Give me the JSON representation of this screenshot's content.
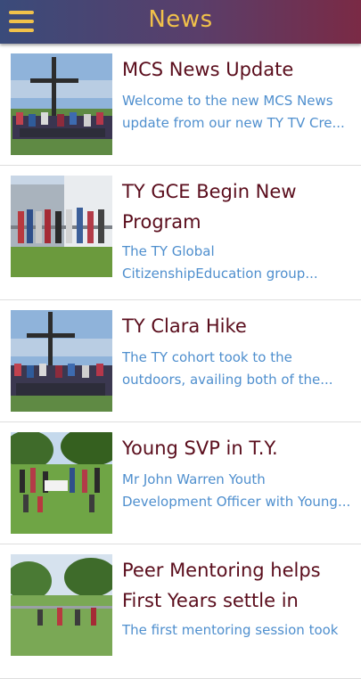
{
  "header": {
    "title": "News",
    "menu_icon": "hamburger-menu-icon"
  },
  "colors": {
    "accent": "#f1c14a",
    "title": "#5a0d1c",
    "link": "#4f8fce"
  },
  "news": [
    {
      "title": "MCS News Update",
      "excerpt": "Welcome to the new MCS News update from our new TY TV Cre..."
    },
    {
      "title": "TY GCE Begin New Program",
      "excerpt": "The TY Global CitizenshipEducation group..."
    },
    {
      "title": "TY Clara Hike",
      "excerpt": "The TY cohort took to the outdoors, availing both of the..."
    },
    {
      "title": "Young SVP in T.Y.",
      "excerpt": "Mr John Warren Youth Development Officer with Young..."
    },
    {
      "title": "Peer Mentoring helps First Years settle in",
      "excerpt": "The first mentoring session took"
    }
  ]
}
